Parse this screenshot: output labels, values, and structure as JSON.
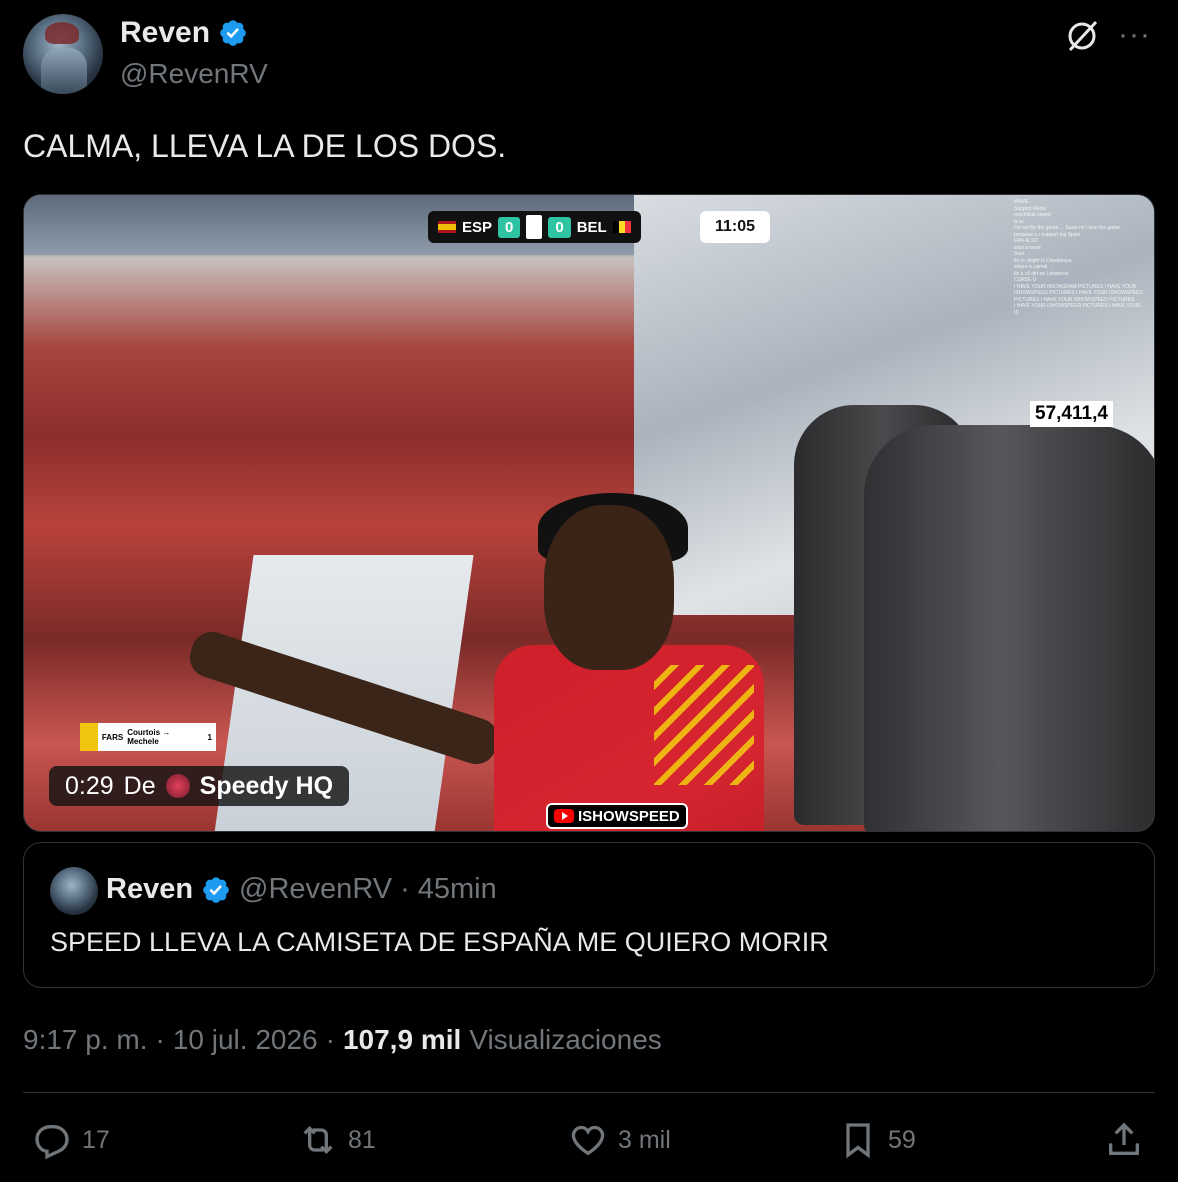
{
  "author": {
    "display_name": "Reven",
    "handle": "@RevenRV"
  },
  "tweet": {
    "text": "CALMA, LLEVA LA DE LOS DOS."
  },
  "media": {
    "scoreboard": {
      "home": "ESP",
      "home_score": "0",
      "away": "BEL",
      "away_score": "0",
      "clock": "11:05"
    },
    "viewer_count": "57,411,4",
    "substitution": "Courtois → Mechele",
    "substitution_label": "FARS",
    "substitution_num": "1",
    "timer": "0:29",
    "timer_prefix": "De",
    "source": "Speedy HQ",
    "watermark": "ISHOWSPEED",
    "chat_lines": [
      "WAVE",
      "Support Messi",
      "ronchibuit speed",
      "is sc",
      "I'm not for the game.... Susie ml I love the game",
      "because u r support ing Spain",
      "FAN ALSO",
      "start a wave",
      "Sure",
      "its ro Jeight is Cheeboaya",
      "where is yamal",
      "Its a ull dirt on Lebanese",
      "CURSE U",
      "I HAVE YOUR INSTAGRAM PICTURES I HAVE YOUR",
      "ISHOWSPEED PICTURES I HAVE YOUR ISHOWSPEED",
      "PICTURES I HAVE YOUR ISHOWSPEED PICTURES",
      "I HAVE YOUR ISHOWSPEED PICTURES I HAVE YOUR",
      "IS"
    ]
  },
  "quote": {
    "display_name": "Reven",
    "handle": "@RevenRV",
    "separator": "·",
    "time": "45min",
    "text": "SPEED LLEVA LA CAMISETA DE ESPAÑA ME QUIERO MORIR"
  },
  "meta": {
    "time": "9:17 p. m.",
    "sep1": "·",
    "date": "10 jul. 2026",
    "sep2": "·",
    "views_count": "107,9 mil",
    "views_label": "Visualizaciones"
  },
  "actions": {
    "replies": "17",
    "reposts": "81",
    "likes": "3 mil",
    "bookmarks": "59"
  },
  "colors": {
    "background": "#000000",
    "text": "#e7e9ea",
    "muted": "#71767b",
    "border": "#2f3336",
    "verified": "#1d9bf0"
  }
}
